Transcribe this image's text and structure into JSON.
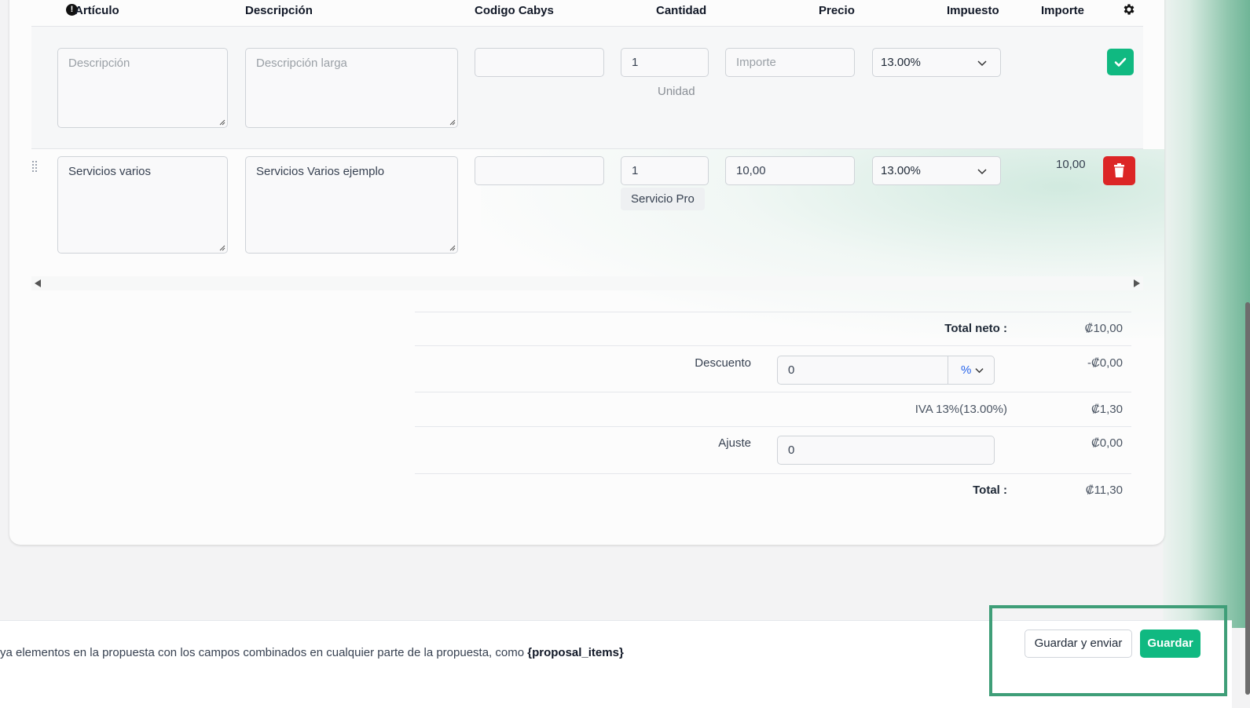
{
  "table": {
    "headers": {
      "articulo": "Artículo",
      "descripcion": "Descripción",
      "cabys": "Codigo Cabys",
      "cantidad": "Cantidad",
      "precio": "Precio",
      "impuesto": "Impuesto",
      "importe": "Importe"
    },
    "info_icon": "info-icon",
    "settings_icon": "gear-icon"
  },
  "new_item": {
    "description_placeholder": "Descripción",
    "long_description_placeholder": "Descripción larga",
    "cabys_value": "",
    "quantity": "1",
    "unit": "Unidad",
    "rate_placeholder": "Importe",
    "tax": "13.00%",
    "add_icon": "check-icon"
  },
  "items": [
    {
      "description": "Servicios varios",
      "long_description": "Servicios Varios ejemplo",
      "cabys": "",
      "quantity": "1",
      "unit": "Servicio Pro",
      "rate": "10,00",
      "tax": "13.00%",
      "amount": "10,00",
      "remove_icon": "trash-icon"
    }
  ],
  "totals": {
    "subtotal_label": "Total neto :",
    "subtotal_value": "₡10,00",
    "discount_label": "Descuento",
    "discount_input": "0",
    "discount_type": "%",
    "discount_value": "-₡0,00",
    "tax_label": "IVA 13%(13.00%)",
    "tax_value": "₡1,30",
    "adjustment_label": "Ajuste",
    "adjustment_input": "0",
    "adjustment_value": "₡0,00",
    "total_label": "Total :",
    "total_value": "₡11,30"
  },
  "footer": {
    "hint_text": "ya elementos en la propuesta con los campos combinados en cualquier parte de la propuesta, como ",
    "hint_tag": "{proposal_items}",
    "save_send_label": "Guardar y enviar",
    "save_label": "Guardar"
  },
  "colors": {
    "primary": "#10b981",
    "danger": "#dc2626",
    "highlight": "#3f9e78",
    "link": "#2563eb"
  }
}
